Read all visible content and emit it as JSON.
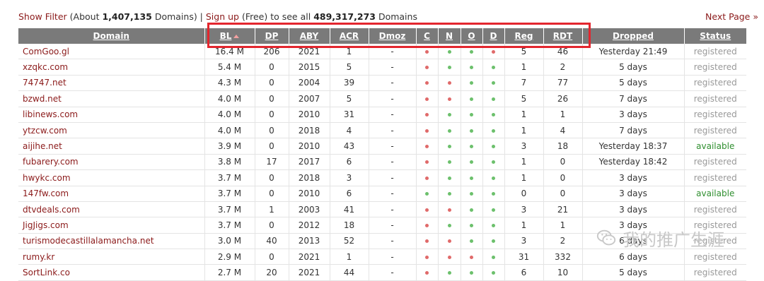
{
  "topbar": {
    "show_filter": "Show Filter",
    "about_prefix": " (About ",
    "domain_count": "1,407,135",
    "domains_suffix": " Domains) | ",
    "sign_up": "Sign up",
    "free_text": " (Free) to see all ",
    "total_count": "489,317,273",
    "total_suffix": " Domains",
    "next_page": "Next Page »"
  },
  "columns": {
    "domain": "Domain",
    "bl": "BL",
    "dp": "DP",
    "aby": "ABY",
    "acr": "ACR",
    "dmoz": "Dmoz",
    "c": "C",
    "n": "N",
    "o": "O",
    "d": "D",
    "reg": "Reg",
    "rdt": "RDT",
    "dropped": "Dropped",
    "status": "Status"
  },
  "colors": {
    "dot_red": "#e06a6a",
    "dot_green": "#6cc06c",
    "link": "#8b1a1a",
    "available": "#2f8f2f",
    "highlight_box": "#e3262e"
  },
  "rows": [
    {
      "domain": "ComGoo.gl",
      "bl": "16.4 M",
      "dp": "206",
      "aby": "2021",
      "acr": "1",
      "dmoz": "-",
      "c": "r",
      "n": "g",
      "o": "g",
      "d": "r",
      "reg": "5",
      "rdt": "46",
      "dropped": "Yesterday 21:49",
      "status": "registered"
    },
    {
      "domain": "xzqkc.com",
      "bl": "5.4 M",
      "dp": "0",
      "aby": "2015",
      "acr": "5",
      "dmoz": "-",
      "c": "r",
      "n": "g",
      "o": "g",
      "d": "g",
      "reg": "1",
      "rdt": "2",
      "dropped": "5 days",
      "status": "registered"
    },
    {
      "domain": "74747.net",
      "bl": "4.3 M",
      "dp": "0",
      "aby": "2004",
      "acr": "39",
      "dmoz": "-",
      "c": "r",
      "n": "r",
      "o": "g",
      "d": "g",
      "reg": "7",
      "rdt": "77",
      "dropped": "5 days",
      "status": "registered"
    },
    {
      "domain": "bzwd.net",
      "bl": "4.0 M",
      "dp": "0",
      "aby": "2007",
      "acr": "5",
      "dmoz": "-",
      "c": "r",
      "n": "r",
      "o": "g",
      "d": "g",
      "reg": "5",
      "rdt": "26",
      "dropped": "7 days",
      "status": "registered"
    },
    {
      "domain": "libinews.com",
      "bl": "4.0 M",
      "dp": "0",
      "aby": "2010",
      "acr": "31",
      "dmoz": "-",
      "c": "r",
      "n": "g",
      "o": "g",
      "d": "g",
      "reg": "1",
      "rdt": "1",
      "dropped": "3 days",
      "status": "registered"
    },
    {
      "domain": "ytzcw.com",
      "bl": "4.0 M",
      "dp": "0",
      "aby": "2018",
      "acr": "4",
      "dmoz": "-",
      "c": "r",
      "n": "g",
      "o": "g",
      "d": "g",
      "reg": "1",
      "rdt": "4",
      "dropped": "7 days",
      "status": "registered"
    },
    {
      "domain": "aijihe.net",
      "bl": "3.9 M",
      "dp": "0",
      "aby": "2010",
      "acr": "43",
      "dmoz": "-",
      "c": "r",
      "n": "g",
      "o": "g",
      "d": "g",
      "reg": "3",
      "rdt": "18",
      "dropped": "Yesterday 18:37",
      "status": "available"
    },
    {
      "domain": "fubarery.com",
      "bl": "3.8 M",
      "dp": "17",
      "aby": "2017",
      "acr": "6",
      "dmoz": "-",
      "c": "r",
      "n": "g",
      "o": "g",
      "d": "g",
      "reg": "1",
      "rdt": "0",
      "dropped": "Yesterday 18:42",
      "status": "registered"
    },
    {
      "domain": "hwykc.com",
      "bl": "3.7 M",
      "dp": "0",
      "aby": "2018",
      "acr": "3",
      "dmoz": "-",
      "c": "r",
      "n": "g",
      "o": "g",
      "d": "g",
      "reg": "1",
      "rdt": "0",
      "dropped": "3 days",
      "status": "registered"
    },
    {
      "domain": "147fw.com",
      "bl": "3.7 M",
      "dp": "0",
      "aby": "2010",
      "acr": "6",
      "dmoz": "-",
      "c": "g",
      "n": "g",
      "o": "g",
      "d": "g",
      "reg": "0",
      "rdt": "0",
      "dropped": "3 days",
      "status": "available"
    },
    {
      "domain": "dtvdeals.com",
      "bl": "3.7 M",
      "dp": "1",
      "aby": "2003",
      "acr": "41",
      "dmoz": "-",
      "c": "r",
      "n": "r",
      "o": "g",
      "d": "g",
      "reg": "3",
      "rdt": "21",
      "dropped": "3 days",
      "status": "registered"
    },
    {
      "domain": "JigJigs.com",
      "bl": "3.7 M",
      "dp": "0",
      "aby": "2012",
      "acr": "18",
      "dmoz": "-",
      "c": "r",
      "n": "g",
      "o": "g",
      "d": "g",
      "reg": "1",
      "rdt": "1",
      "dropped": "3 days",
      "status": "registered"
    },
    {
      "domain": "turismodecastillalamancha.net",
      "bl": "3.0 M",
      "dp": "40",
      "aby": "2013",
      "acr": "52",
      "dmoz": "-",
      "c": "r",
      "n": "r",
      "o": "g",
      "d": "g",
      "reg": "3",
      "rdt": "2",
      "dropped": "6 days",
      "status": "registered"
    },
    {
      "domain": "rumy.kr",
      "bl": "2.9 M",
      "dp": "0",
      "aby": "2021",
      "acr": "1",
      "dmoz": "-",
      "c": "r",
      "n": "r",
      "o": "r",
      "d": "g",
      "reg": "31",
      "rdt": "332",
      "dropped": "6 days",
      "status": "registered"
    },
    {
      "domain": "SortLink.co",
      "bl": "2.7 M",
      "dp": "20",
      "aby": "2021",
      "acr": "44",
      "dmoz": "-",
      "c": "r",
      "n": "g",
      "o": "g",
      "d": "g",
      "reg": "6",
      "rdt": "10",
      "dropped": "5 days",
      "status": "registered"
    }
  ],
  "watermark": {
    "text": "我的推广生涯",
    "icon": "wechat-icon"
  }
}
